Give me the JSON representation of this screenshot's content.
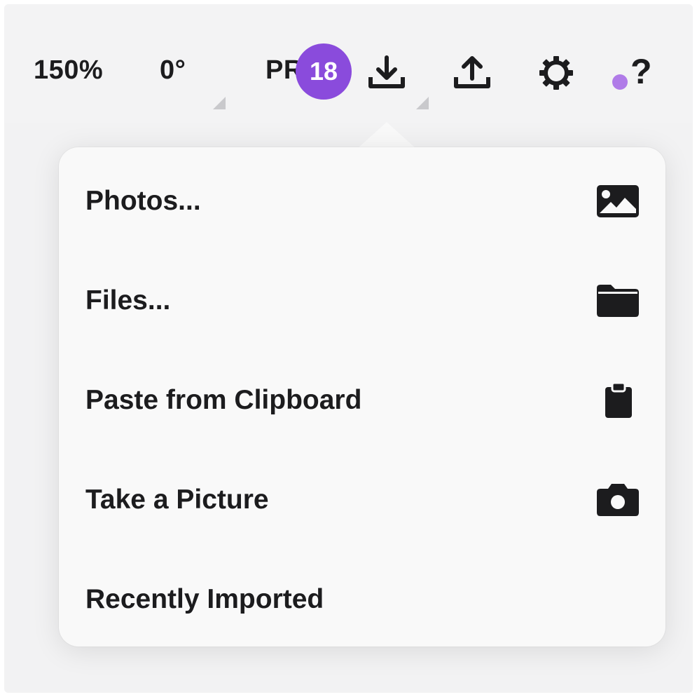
{
  "toolbar": {
    "zoom_label": "150%",
    "rotation_label": "0°",
    "pr_label": "PR",
    "badge_count": "18",
    "help_label": "?",
    "icons": [
      "download-icon",
      "upload-icon",
      "gear-icon",
      "help-icon"
    ],
    "colors": {
      "badge": "#8a4bdc",
      "help_dot": "#b07be8"
    }
  },
  "import_menu": {
    "items": [
      {
        "label": "Photos...",
        "icon": "photo-icon"
      },
      {
        "label": "Files...",
        "icon": "folder-icon"
      },
      {
        "label": "Paste from Clipboard",
        "icon": "clipboard-icon"
      },
      {
        "label": "Take a Picture",
        "icon": "camera-icon"
      },
      {
        "label": "Recently Imported",
        "icon": ""
      }
    ]
  }
}
